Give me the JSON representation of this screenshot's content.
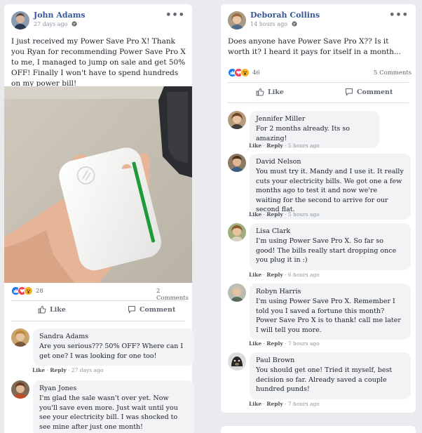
{
  "left_post": {
    "author": "John Adams",
    "time": "27 days ago",
    "text": "I just received my Power Save Pro X! Thank you Ryan for recommending Power Save Pro X to me, I managed to jump on sale and get 50% OFF! Finally I won't have to spend hundreds on my power bill!",
    "reaction_count": "28",
    "comments_count": "2 Comments",
    "like_label": "Like",
    "comment_label": "Comment",
    "comments": [
      {
        "name": "Sandra Adams",
        "text": "Are you serious??? 50% OFF? Where can I get one? I was looking for one too!",
        "like": "Like",
        "reply": "Reply",
        "time": "27 days ago"
      },
      {
        "name": "Ryan Jones",
        "text": "I'm glad the sale wasn't over yet. Now you'll save even more. Just wait until you see your electricity bill. I was shocked to see mine after just one month!"
      }
    ]
  },
  "right_post": {
    "author": "Deborah Collins",
    "time": "14 hours ago",
    "text": "Does anyone have Power Save Pro X?? Is it worth it? I heard it pays for itself in a month...",
    "reaction_count": "46",
    "comments_count": "5 Comments",
    "like_label": "Like",
    "comment_label": "Comment",
    "comments": [
      {
        "name": "Jennifer Miller",
        "text": "For 2 months already. Its so amazing!",
        "like": "Like",
        "reply": "Reply",
        "time": "5 hours ago"
      },
      {
        "name": "David Nelson",
        "text": "You must try it. Mandy and I use it. It really cuts your electricity bills. We got one a few months ago to test it and now we're waiting for the second to arrive for our second flat.",
        "like": "Like",
        "reply": "Reply",
        "time": "5 hours ago"
      },
      {
        "name": "Lisa Clark",
        "text": "I'm using Power Save Pro X. So far so good! The bills really start dropping once you plug it in :)",
        "like": "Like",
        "reply": "Reply",
        "time": "6 hours ago"
      },
      {
        "name": "Robyn Harris",
        "text": "I'm using Power Save Pro X. Remember I told you I saved a fortune this month? Power Save Pro X is to thank! call me later I will tell you more.",
        "like": "Like",
        "reply": "Reply",
        "time": "7 hours ago"
      },
      {
        "name": "Paul Brown",
        "text": "You should get one! Tried it myself, best decision so far. Already saved a couple hundred punds!",
        "like": "Like",
        "reply": "Reply",
        "time": "7 hours ago"
      }
    ]
  },
  "icons": {
    "more": "more-dots-icon",
    "privacy": "globe-icon",
    "like_reaction": "thumbs-up-icon",
    "love_reaction": "heart-icon",
    "wow_reaction": "wow-icon",
    "like_action": "thumbs-up-outline-icon",
    "comment_action": "speech-bubble-icon"
  },
  "colors": {
    "name_blue": "#385898",
    "like_blue": "#1877f2",
    "love_red": "#f33e58",
    "wow_yellow": "#f7b125",
    "bubble_gray": "#f2f3f5",
    "device_green": "#1f9a3a"
  }
}
